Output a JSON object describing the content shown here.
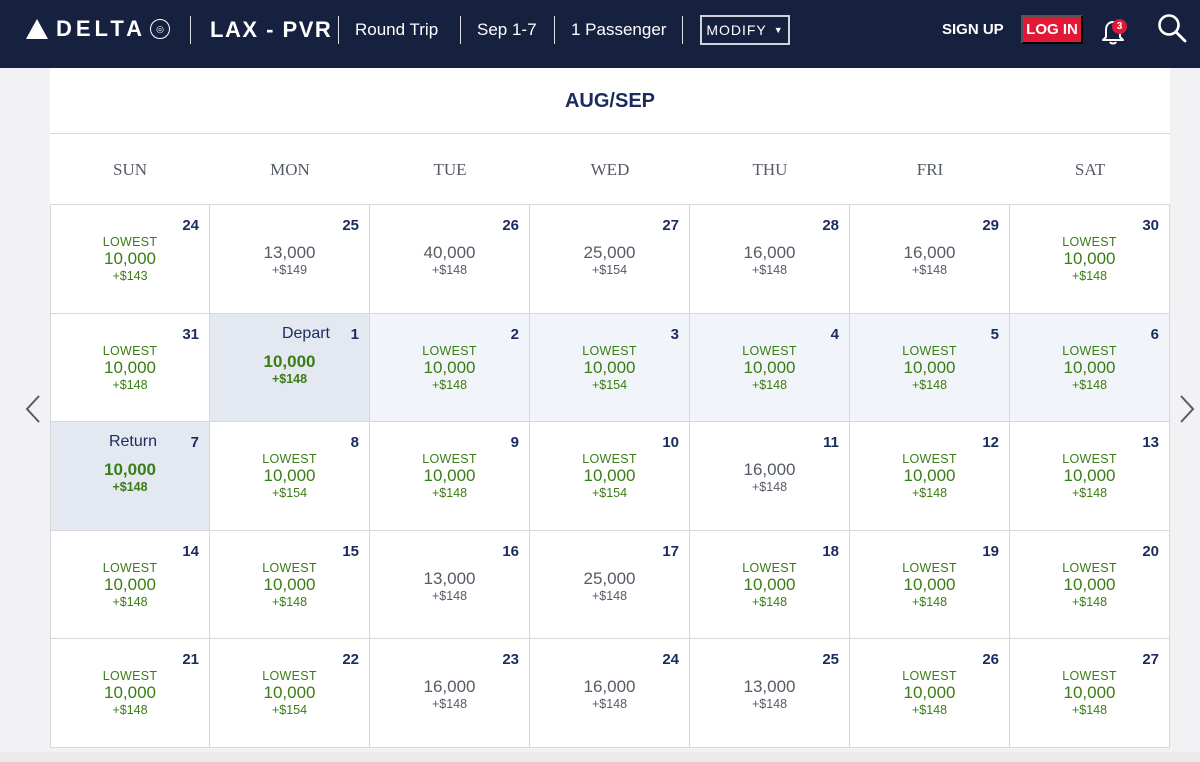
{
  "header": {
    "logo_text": "DELTA",
    "route": "LAX - PVR",
    "trip_type": "Round Trip",
    "dates": "Sep 1-7",
    "passengers": "1 Passenger",
    "modify_label": "MODIFY",
    "signup_label": "SIGN UP",
    "login_label": "LOG IN",
    "notification_count": "3",
    "brand_color": "#16213f",
    "accent_red": "#e31837"
  },
  "calendar": {
    "month_label": "AUG/SEP",
    "weekdays": [
      "SUN",
      "MON",
      "TUE",
      "WED",
      "THU",
      "FRI",
      "SAT"
    ],
    "weeks": [
      [
        {
          "day": "24",
          "tag": "LOWEST",
          "miles": "10,000",
          "fee": "+$143",
          "low": true
        },
        {
          "day": "25",
          "tag": "",
          "miles": "13,000",
          "fee": "+$149",
          "low": false
        },
        {
          "day": "26",
          "tag": "",
          "miles": "40,000",
          "fee": "+$148",
          "low": false
        },
        {
          "day": "27",
          "tag": "",
          "miles": "25,000",
          "fee": "+$154",
          "low": false
        },
        {
          "day": "28",
          "tag": "",
          "miles": "16,000",
          "fee": "+$148",
          "low": false
        },
        {
          "day": "29",
          "tag": "",
          "miles": "16,000",
          "fee": "+$148",
          "low": false
        },
        {
          "day": "30",
          "tag": "LOWEST",
          "miles": "10,000",
          "fee": "+$148",
          "low": true
        }
      ],
      [
        {
          "day": "31",
          "tag": "LOWEST",
          "miles": "10,000",
          "fee": "+$148",
          "low": true
        },
        {
          "day": "1",
          "label": "Depart",
          "tag": "",
          "miles": "10,000",
          "fee": "+$148",
          "low": true,
          "state": "selected"
        },
        {
          "day": "2",
          "tag": "LOWEST",
          "miles": "10,000",
          "fee": "+$148",
          "low": true,
          "state": "range"
        },
        {
          "day": "3",
          "tag": "LOWEST",
          "miles": "10,000",
          "fee": "+$154",
          "low": true,
          "state": "range"
        },
        {
          "day": "4",
          "tag": "LOWEST",
          "miles": "10,000",
          "fee": "+$148",
          "low": true,
          "state": "range"
        },
        {
          "day": "5",
          "tag": "LOWEST",
          "miles": "10,000",
          "fee": "+$148",
          "low": true,
          "state": "range"
        },
        {
          "day": "6",
          "tag": "LOWEST",
          "miles": "10,000",
          "fee": "+$148",
          "low": true,
          "state": "range"
        }
      ],
      [
        {
          "day": "7",
          "label": "Return",
          "tag": "",
          "miles": "10,000",
          "fee": "+$148",
          "low": true,
          "state": "selected"
        },
        {
          "day": "8",
          "tag": "LOWEST",
          "miles": "10,000",
          "fee": "+$154",
          "low": true
        },
        {
          "day": "9",
          "tag": "LOWEST",
          "miles": "10,000",
          "fee": "+$148",
          "low": true
        },
        {
          "day": "10",
          "tag": "LOWEST",
          "miles": "10,000",
          "fee": "+$154",
          "low": true
        },
        {
          "day": "11",
          "tag": "",
          "miles": "16,000",
          "fee": "+$148",
          "low": false
        },
        {
          "day": "12",
          "tag": "LOWEST",
          "miles": "10,000",
          "fee": "+$148",
          "low": true
        },
        {
          "day": "13",
          "tag": "LOWEST",
          "miles": "10,000",
          "fee": "+$148",
          "low": true
        }
      ],
      [
        {
          "day": "14",
          "tag": "LOWEST",
          "miles": "10,000",
          "fee": "+$148",
          "low": true
        },
        {
          "day": "15",
          "tag": "LOWEST",
          "miles": "10,000",
          "fee": "+$148",
          "low": true
        },
        {
          "day": "16",
          "tag": "",
          "miles": "13,000",
          "fee": "+$148",
          "low": false
        },
        {
          "day": "17",
          "tag": "",
          "miles": "25,000",
          "fee": "+$148",
          "low": false
        },
        {
          "day": "18",
          "tag": "LOWEST",
          "miles": "10,000",
          "fee": "+$148",
          "low": true
        },
        {
          "day": "19",
          "tag": "LOWEST",
          "miles": "10,000",
          "fee": "+$148",
          "low": true
        },
        {
          "day": "20",
          "tag": "LOWEST",
          "miles": "10,000",
          "fee": "+$148",
          "low": true
        }
      ],
      [
        {
          "day": "21",
          "tag": "LOWEST",
          "miles": "10,000",
          "fee": "+$148",
          "low": true
        },
        {
          "day": "22",
          "tag": "LOWEST",
          "miles": "10,000",
          "fee": "+$154",
          "low": true
        },
        {
          "day": "23",
          "tag": "",
          "miles": "16,000",
          "fee": "+$148",
          "low": false
        },
        {
          "day": "24",
          "tag": "",
          "miles": "16,000",
          "fee": "+$148",
          "low": false
        },
        {
          "day": "25",
          "tag": "",
          "miles": "13,000",
          "fee": "+$148",
          "low": false
        },
        {
          "day": "26",
          "tag": "LOWEST",
          "miles": "10,000",
          "fee": "+$148",
          "low": true
        },
        {
          "day": "27",
          "tag": "LOWEST",
          "miles": "10,000",
          "fee": "+$148",
          "low": true
        }
      ]
    ]
  },
  "icons": {
    "prev": "chevron-left-icon",
    "next": "chevron-right-icon",
    "bell": "bell-icon",
    "search": "search-icon",
    "logo": "delta-widget-icon"
  }
}
